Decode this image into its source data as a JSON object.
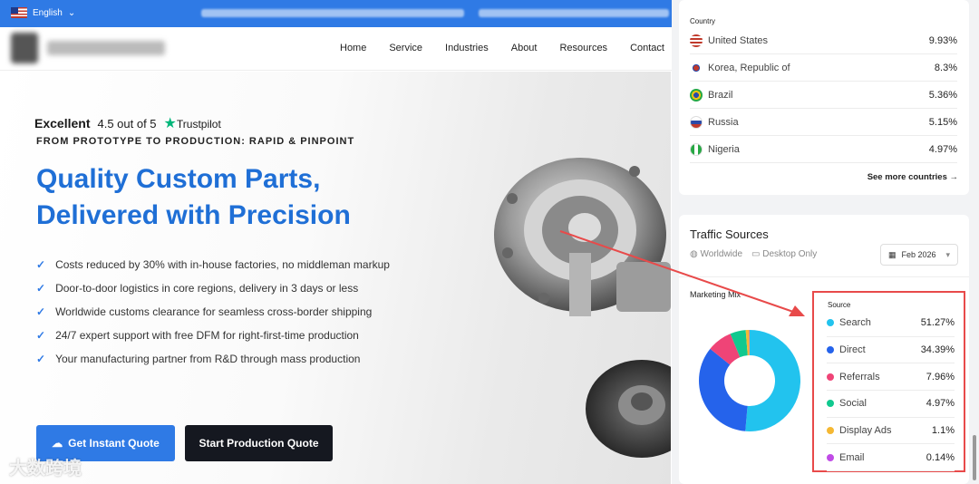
{
  "topbar": {
    "language": "English"
  },
  "nav": {
    "items": [
      "Home",
      "Service",
      "Industries",
      "About",
      "Resources",
      "Contact"
    ]
  },
  "hero": {
    "rating_word": "Excellent",
    "rating_text": "4.5 out of 5",
    "trustpilot": "Trustpilot",
    "tagline": "FROM PROTOTYPE TO PRODUCTION: RAPID & PINPOINT",
    "headline_1": "Quality Custom Parts,",
    "headline_2": "Delivered with Precision",
    "bullets": [
      "Costs reduced by 30% with in-house factories, no middleman markup",
      "Door-to-door logistics in core regions, delivery in 3 days or less",
      "Worldwide customs clearance for seamless cross-border shipping",
      "24/7 expert support with free DFM for right-first-time production",
      "Your manufacturing partner from R&D through mass production"
    ],
    "cta_primary": "Get Instant Quote",
    "cta_secondary": "Start Production Quote"
  },
  "watermark": "大数跨境",
  "country_panel": {
    "label": "Country",
    "rows": [
      {
        "name": "United States",
        "pct": "9.93%"
      },
      {
        "name": "Korea, Republic of",
        "pct": "8.3%"
      },
      {
        "name": "Brazil",
        "pct": "5.36%"
      },
      {
        "name": "Russia",
        "pct": "5.15%"
      },
      {
        "name": "Nigeria",
        "pct": "4.97%"
      }
    ],
    "see_more": "See more countries"
  },
  "traffic": {
    "title": "Traffic Sources",
    "scope": "Worldwide",
    "device": "Desktop Only",
    "date": "Feb 2026",
    "mix_label": "Marketing Mix",
    "source_label": "Source",
    "sources": [
      {
        "name": "Search",
        "pct": "51.27%",
        "value": 51.27,
        "color": "#22c3ee"
      },
      {
        "name": "Direct",
        "pct": "34.39%",
        "value": 34.39,
        "color": "#2563eb"
      },
      {
        "name": "Referrals",
        "pct": "7.96%",
        "value": 7.96,
        "color": "#ef4477"
      },
      {
        "name": "Social",
        "pct": "4.97%",
        "value": 4.97,
        "color": "#10c98f"
      },
      {
        "name": "Display Ads",
        "pct": "1.1%",
        "value": 1.1,
        "color": "#f5b833"
      },
      {
        "name": "Email",
        "pct": "0.14%",
        "value": 0.14,
        "color": "#c04be6"
      }
    ]
  }
}
